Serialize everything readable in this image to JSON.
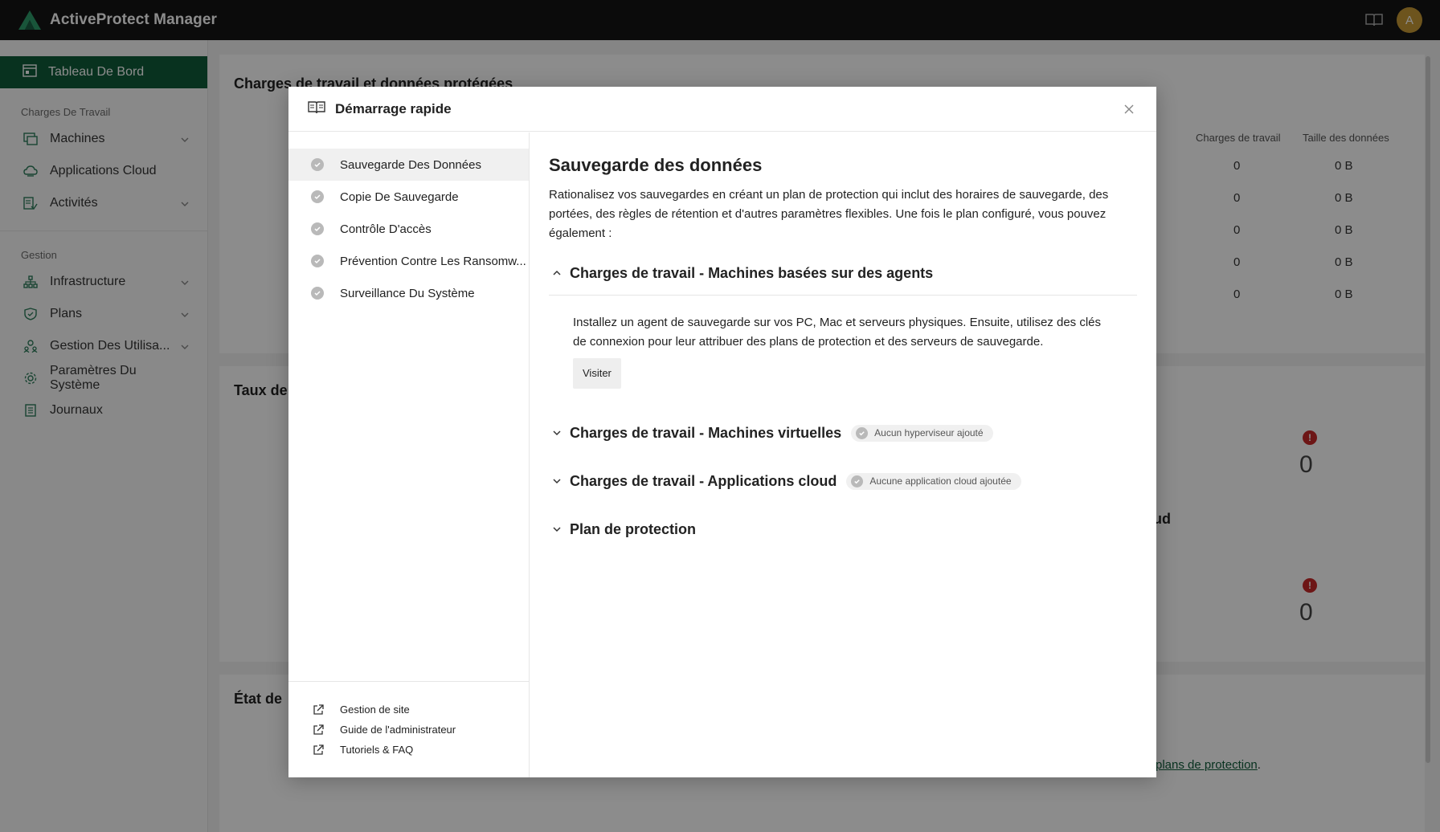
{
  "app": {
    "title": "ActiveProtect Manager",
    "avatar_letter": "A",
    "brand_color": "#0f5b3a"
  },
  "sidebar": {
    "active_item": "Tableau De Bord",
    "sections": [
      {
        "label": "Charges De Travail",
        "items": [
          "Machines",
          "Applications Cloud",
          "Activités"
        ]
      },
      {
        "label": "Gestion",
        "items": [
          "Infrastructure",
          "Plans",
          "Gestion Des Utilisa...",
          "Paramètres Du Système",
          "Journaux"
        ]
      }
    ]
  },
  "background": {
    "card1_title": "Charges de travail et données protégées",
    "col_workloads": "Charges de travail",
    "col_data_size": "Taille des données",
    "rows": [
      {
        "workloads": "0",
        "size": "0 B"
      },
      {
        "workloads": "0",
        "size": "0 B"
      },
      {
        "workloads": "0",
        "size": "0 B"
      },
      {
        "workloads": "0",
        "size": "0 B"
      },
      {
        "workloads": "0",
        "size": "0 B"
      }
    ],
    "card2_title_fragment": "Taux de",
    "card2_right_fragment": "ud",
    "zero_1": "0",
    "zero_2": "0",
    "card3_title_fragment": "État de",
    "link_fragment": "plans de protection",
    "link_suffix": "."
  },
  "modal": {
    "title": "Démarrage rapide",
    "steps": [
      "Sauvegarde Des Données",
      "Copie De Sauvegarde",
      "Contrôle D'accès",
      "Prévention Contre Les Ransomw...",
      "Surveillance Du Système"
    ],
    "links": [
      "Gestion de site",
      "Guide de l'administrateur",
      "Tutoriels & FAQ"
    ],
    "content_title": "Sauvegarde des données",
    "content_desc": "Rationalisez vos sauvegardes en créant un plan de protection qui inclut des horaires de sauvegarde, des portées, des règles de rétention et d'autres paramètres flexibles. Une fois le plan configuré, vous pouvez également :",
    "accordions": [
      {
        "title": "Charges de travail - Machines basées sur des agents",
        "expanded": true,
        "body": "Installez un agent de sauvegarde sur vos PC, Mac et serveurs physiques. Ensuite, utilisez des clés de connexion pour leur attribuer des plans de protection et des serveurs de sauvegarde.",
        "button": "Visiter"
      },
      {
        "title": "Charges de travail - Machines virtuelles",
        "expanded": false,
        "status": "Aucun hyperviseur ajouté"
      },
      {
        "title": "Charges de travail - Applications cloud",
        "expanded": false,
        "status": "Aucune application cloud ajoutée"
      },
      {
        "title": "Plan de protection",
        "expanded": false
      }
    ]
  }
}
